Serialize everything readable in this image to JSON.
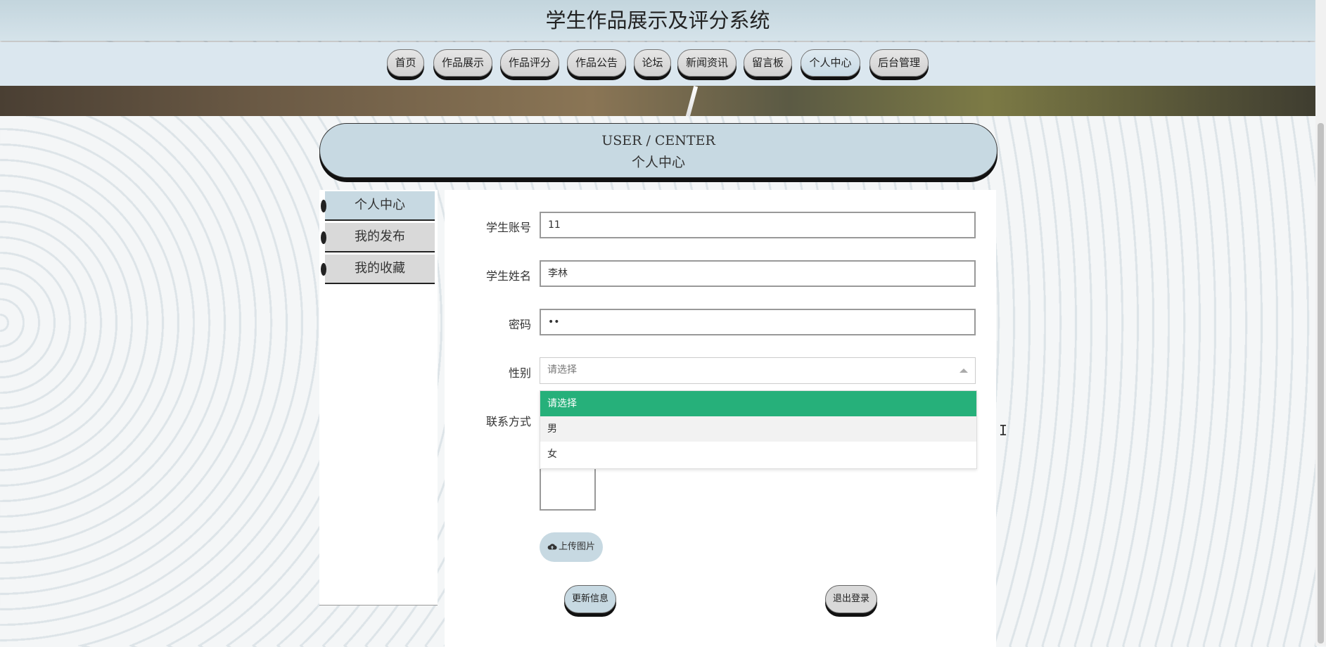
{
  "header": {
    "title": "学生作品展示及评分系统"
  },
  "nav": {
    "items": [
      {
        "label": "首页"
      },
      {
        "label": "作品展示"
      },
      {
        "label": "作品评分"
      },
      {
        "label": "作品公告"
      },
      {
        "label": "论坛"
      },
      {
        "label": "新闻资讯"
      },
      {
        "label": "留言板"
      },
      {
        "label": "个人中心",
        "active": true
      },
      {
        "label": "后台管理"
      }
    ]
  },
  "page_title": {
    "en": "USER / CENTER",
    "cn": "个人中心"
  },
  "sidebar": {
    "items": [
      {
        "label": "个人中心",
        "active": true
      },
      {
        "label": "我的发布"
      },
      {
        "label": "我的收藏"
      }
    ]
  },
  "form": {
    "account": {
      "label": "学生账号",
      "value": "11"
    },
    "name": {
      "label": "学生姓名",
      "value": "李林"
    },
    "password": {
      "label": "密码",
      "value": "••"
    },
    "gender": {
      "label": "性别",
      "placeholder": "请选择",
      "options": [
        "请选择",
        "男",
        "女"
      ],
      "selected": "请选择"
    },
    "contact": {
      "label": "联系方式"
    },
    "upload_label": "上传图片",
    "update_label": "更新信息",
    "logout_label": "退出登录"
  },
  "colors": {
    "accent": "#c7d9e2",
    "dropdown_selected": "#26b07a"
  }
}
